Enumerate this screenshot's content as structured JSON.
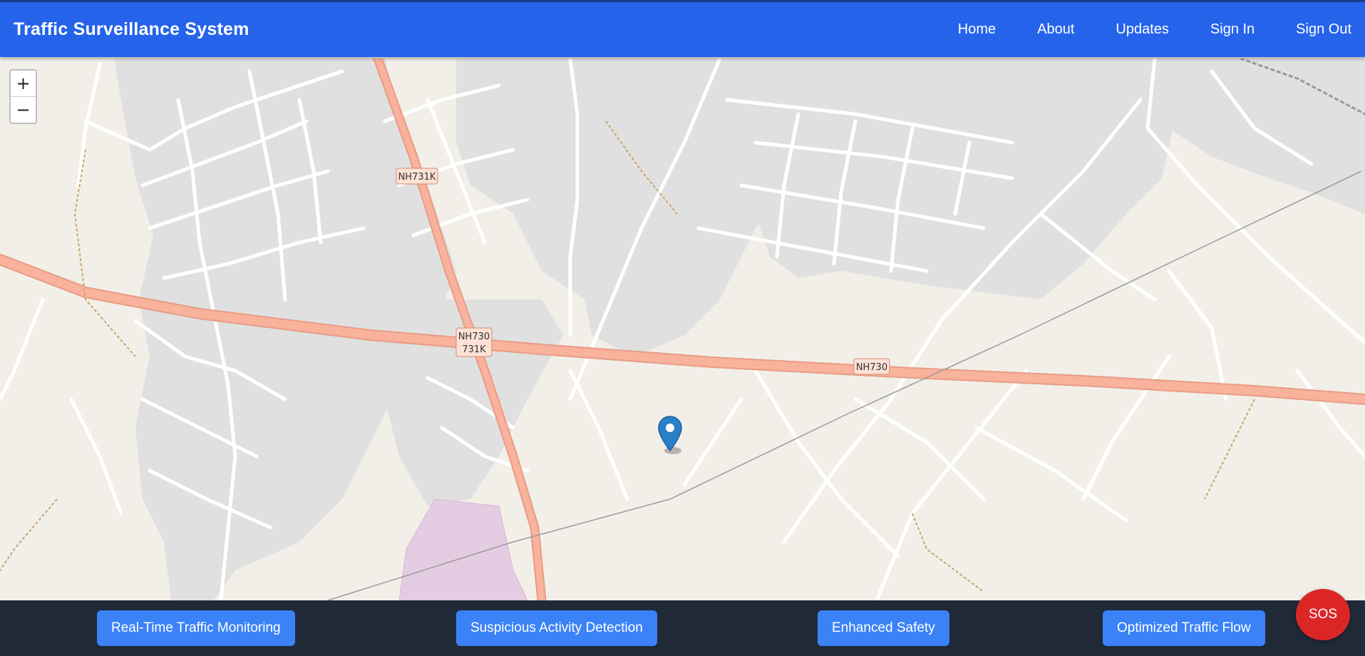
{
  "header": {
    "title": "Traffic Surveillance System",
    "nav": [
      "Home",
      "About",
      "Updates",
      "Sign In",
      "Sign Out"
    ]
  },
  "map": {
    "zoom_in": "+",
    "zoom_out": "−",
    "road_labels": [
      "NH731K",
      "NH730",
      "731K",
      "NH730"
    ],
    "marker_icon": "map-pin-icon",
    "colors": {
      "land": "#f2efe9",
      "residential": "#e0e0e0",
      "trunk": "#f9b29c",
      "trunk_casing": "#e89c85",
      "street": "#ffffff",
      "institutional": "#e4cde2",
      "marker": "#2a7fc9"
    }
  },
  "footer": {
    "features": [
      "Real-Time Traffic Monitoring",
      "Suspicious Activity Detection",
      "Enhanced Safety",
      "Optimized Traffic Flow"
    ],
    "sos_label": "SOS"
  },
  "colors": {
    "header_bg": "#2563eb",
    "footer_bg": "#1f2937",
    "button_bg": "#3b82f6",
    "sos_bg": "#dc2626"
  }
}
